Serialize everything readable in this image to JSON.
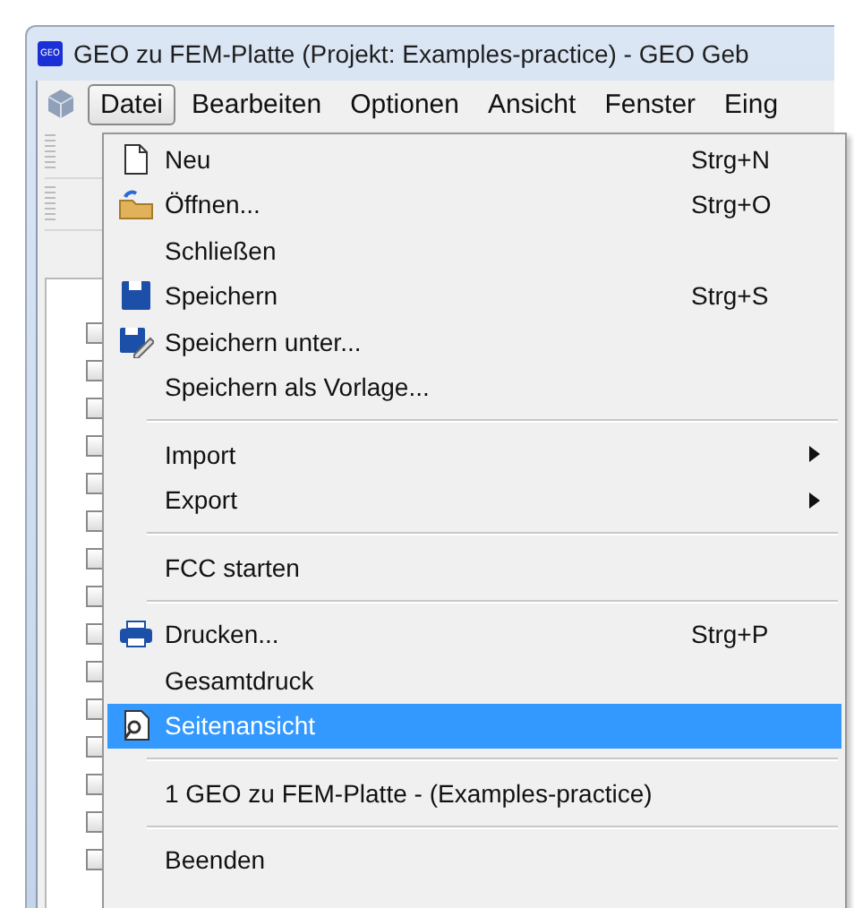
{
  "window": {
    "app_icon_text": "GEO",
    "title": "GEO zu FEM-Platte (Projekt: Examples-practice) - GEO Geb"
  },
  "menu_bar": [
    {
      "label": "Datei",
      "selected": true
    },
    {
      "label": "Bearbeiten",
      "selected": false
    },
    {
      "label": "Optionen",
      "selected": false
    },
    {
      "label": "Ansicht",
      "selected": false
    },
    {
      "label": "Fenster",
      "selected": false
    },
    {
      "label": "Eing",
      "selected": false
    }
  ],
  "file_menu": [
    {
      "kind": "item",
      "label": "Neu",
      "shortcut": "Strg+N",
      "selected": false
    },
    {
      "kind": "item",
      "label": "Öffnen...",
      "shortcut": "Strg+O",
      "selected": false
    },
    {
      "kind": "item",
      "label": "Schließen",
      "selected": false
    },
    {
      "kind": "item",
      "label": "Speichern",
      "shortcut": "Strg+S",
      "selected": false
    },
    {
      "kind": "item",
      "label": "Speichern unter...",
      "selected": false
    },
    {
      "kind": "item",
      "label": "Speichern als Vorlage...",
      "selected": false
    },
    {
      "kind": "separator"
    },
    {
      "kind": "submenu",
      "label": "Import",
      "selected": false
    },
    {
      "kind": "submenu",
      "label": "Export",
      "selected": false
    },
    {
      "kind": "separator"
    },
    {
      "kind": "item",
      "label": "FCC starten",
      "selected": false
    },
    {
      "kind": "separator"
    },
    {
      "kind": "item",
      "label": "Drucken...",
      "shortcut": "Strg+P",
      "selected": false
    },
    {
      "kind": "item",
      "label": "Gesamtdruck",
      "selected": false
    },
    {
      "kind": "item",
      "label": "Seitenansicht",
      "selected": true
    },
    {
      "kind": "separator"
    },
    {
      "kind": "item",
      "label": "1 GEO zu FEM-Platte - (Examples-practice)",
      "selected": false
    },
    {
      "kind": "separator"
    },
    {
      "kind": "item",
      "label": "Beenden",
      "selected": false
    }
  ]
}
